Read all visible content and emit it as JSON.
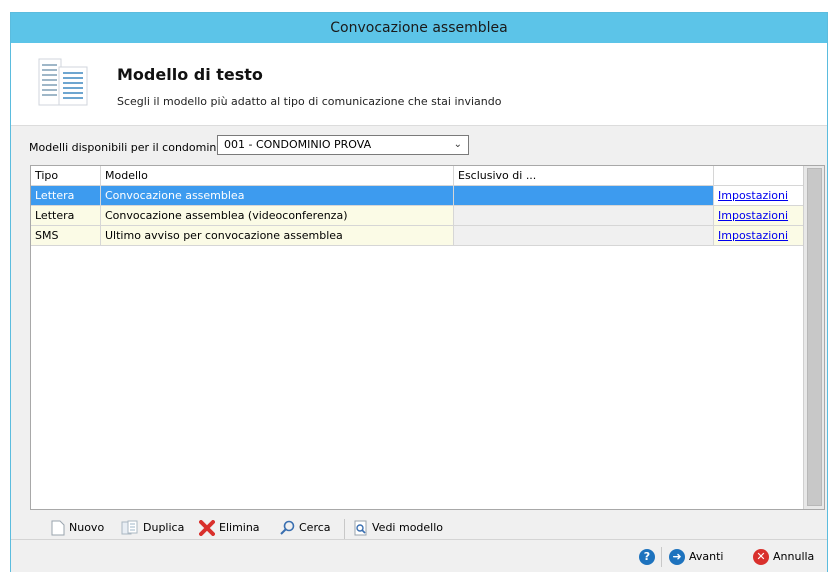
{
  "window": {
    "title": "Convocazione assemblea"
  },
  "header": {
    "title": "Modello di testo",
    "subtitle": "Scegli il modello più adatto al tipo di comunicazione che stai inviando"
  },
  "filter": {
    "label": "Modelli disponibili per il condominio",
    "selected": "001 - CONDOMINIO PROVA"
  },
  "table": {
    "columns": [
      "Tipo",
      "Modello",
      "Esclusivo di ...",
      ""
    ],
    "rows": [
      {
        "tipo": "Lettera",
        "modello": "Convocazione assemblea",
        "esclusivo": "",
        "action": "Impostazioni",
        "selected": true
      },
      {
        "tipo": "Lettera",
        "modello": "Convocazione assemblea (videoconferenza)",
        "esclusivo": "",
        "action": "Impostazioni",
        "selected": false
      },
      {
        "tipo": "SMS",
        "modello": "Ultimo avviso per convocazione assemblea",
        "esclusivo": "",
        "action": "Impostazioni",
        "selected": false
      }
    ]
  },
  "toolbar": {
    "new_label": "Nuovo",
    "duplicate_label": "Duplica",
    "delete_label": "Elimina",
    "search_label": "Cerca",
    "view_label": "Vedi modello"
  },
  "footer": {
    "next_label": "Avanti",
    "cancel_label": "Annulla"
  },
  "colors": {
    "titlebar": "#5cc4e8",
    "selection": "#3d9bef",
    "row_alt": "#fbfbe6",
    "delete_red": "#d9302c",
    "next_blue": "#1e73be"
  }
}
